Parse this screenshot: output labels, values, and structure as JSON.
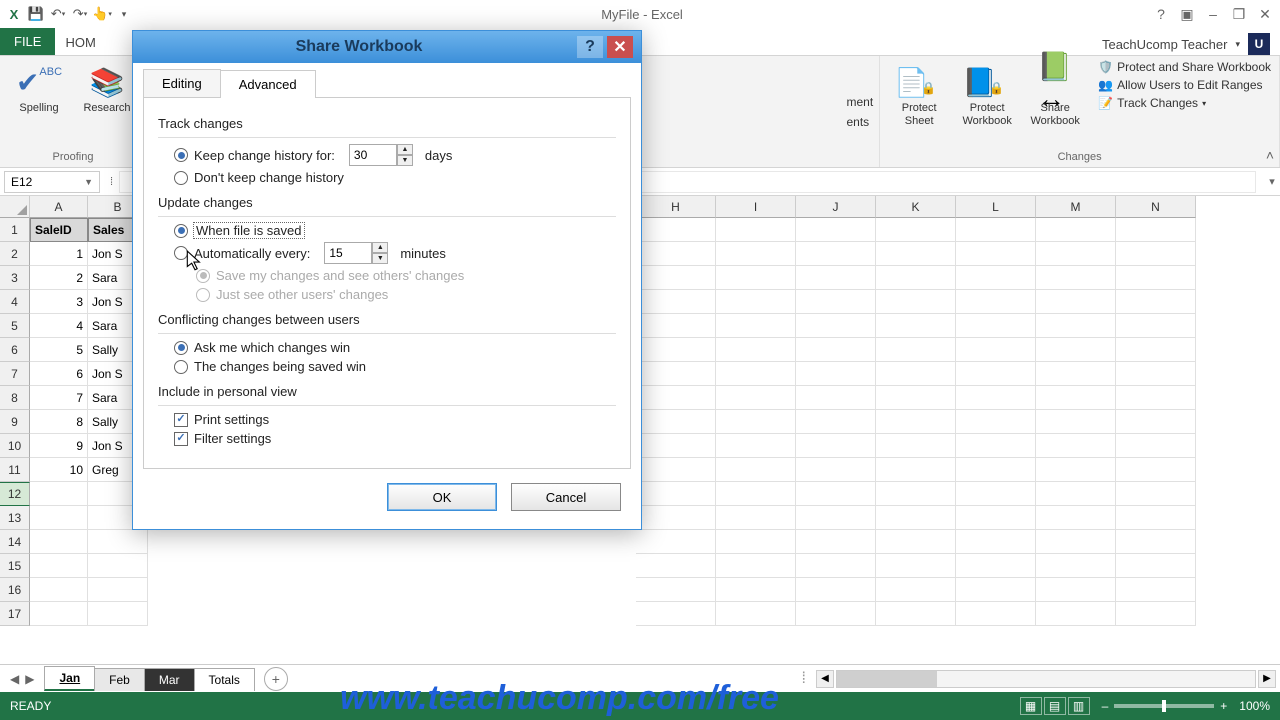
{
  "app": {
    "title": "MyFile - Excel"
  },
  "qat": {
    "excel_icon": "X",
    "save": "save",
    "undo": "undo",
    "redo": "redo",
    "touch": "touch"
  },
  "window_controls": {
    "help": "?",
    "ribbon_opts": "▭",
    "minimize": "–",
    "restore": "❐",
    "close": "✕"
  },
  "ribbon_tabs": {
    "file": "FILE",
    "home_partial": "HOM"
  },
  "user": {
    "name": "TeachUcomp Teacher",
    "initial": "U"
  },
  "ribbon": {
    "proofing": {
      "spelling": "Spelling",
      "research": "Research",
      "label": "Proofing"
    },
    "comments_partial": {
      "line1": "ment",
      "line2": "ents"
    },
    "changes": {
      "protect_sheet": "Protect\nSheet",
      "protect_workbook": "Protect\nWorkbook",
      "share_workbook": "Share\nWorkbook",
      "protect_share": "Protect and Share Workbook",
      "allow_edit": "Allow Users to Edit Ranges",
      "track_changes": "Track Changes",
      "label": "Changes"
    }
  },
  "namebox": "E12",
  "columns": [
    "A",
    "B",
    "H",
    "I",
    "J",
    "K",
    "L",
    "M",
    "N"
  ],
  "partial_col": "B",
  "rows": [
    "1",
    "2",
    "3",
    "4",
    "5",
    "6",
    "7",
    "8",
    "9",
    "10",
    "11",
    "12",
    "13",
    "14",
    "15",
    "16",
    "17"
  ],
  "selected_row": "12",
  "data_rows": [
    {
      "a": "SaleID",
      "b": "Sales"
    },
    {
      "a": "1",
      "b": "Jon S"
    },
    {
      "a": "2",
      "b": "Sara"
    },
    {
      "a": "3",
      "b": "Jon S"
    },
    {
      "a": "4",
      "b": "Sara"
    },
    {
      "a": "5",
      "b": "Sally"
    },
    {
      "a": "6",
      "b": "Jon S"
    },
    {
      "a": "7",
      "b": "Sara"
    },
    {
      "a": "8",
      "b": "Sally"
    },
    {
      "a": "9",
      "b": "Jon S"
    },
    {
      "a": "10",
      "b": "Greg"
    }
  ],
  "sheet_tabs": [
    "Jan",
    "Feb",
    "Mar",
    "Totals"
  ],
  "active_sheet": "Jan",
  "status": {
    "ready": "READY",
    "zoom": "100%"
  },
  "dialog": {
    "title": "Share Workbook",
    "tabs": {
      "editing": "Editing",
      "advanced": "Advanced"
    },
    "track_changes": {
      "heading": "Track changes",
      "keep_history": "Keep change history for:",
      "days_value": "30",
      "days_label": "days",
      "dont_keep": "Don't keep change history"
    },
    "update_changes": {
      "heading": "Update changes",
      "when_saved": "When file is saved",
      "auto_every": "Automatically every:",
      "minutes_value": "15",
      "minutes_label": "minutes",
      "save_see": "Save my changes and see others' changes",
      "just_see": "Just see other users' changes"
    },
    "conflicting": {
      "heading": "Conflicting changes between users",
      "ask": "Ask me which changes win",
      "saved_win": "The changes being saved win"
    },
    "personal_view": {
      "heading": "Include in personal view",
      "print": "Print settings",
      "filter": "Filter settings"
    },
    "ok": "OK",
    "cancel": "Cancel"
  },
  "watermark": "www.teachucomp.com/free"
}
